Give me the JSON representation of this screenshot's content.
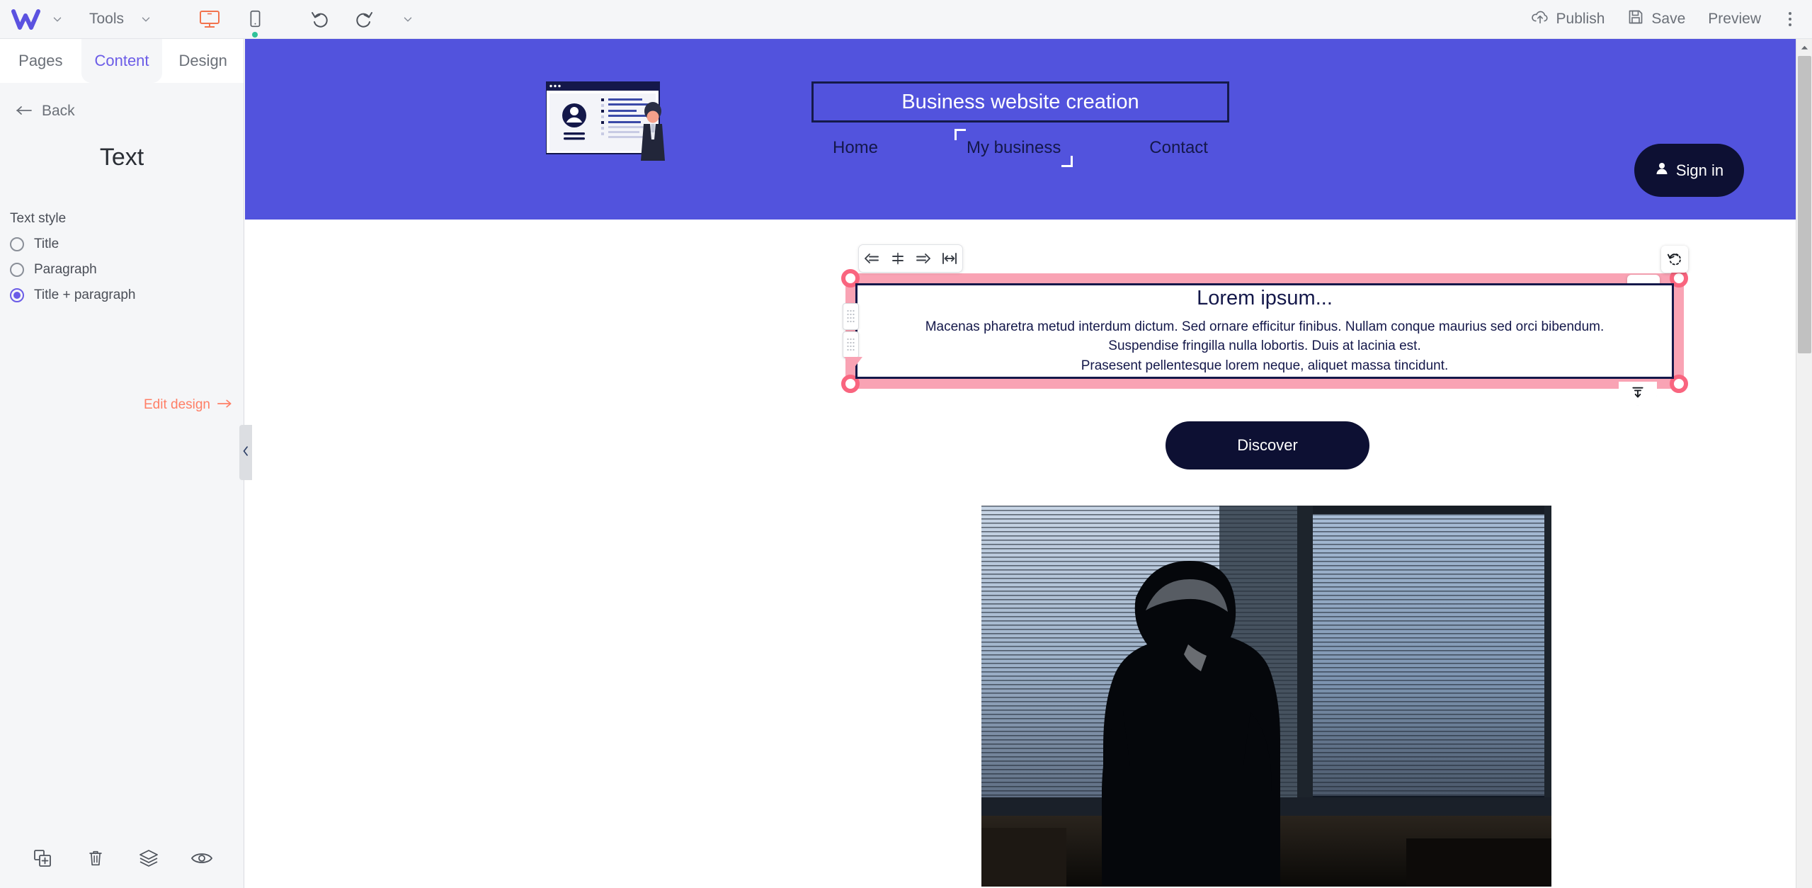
{
  "topbar": {
    "brand_icon": "w-logo-icon",
    "brand_chevron_icon": "chevron-down-icon",
    "tools_label": "Tools",
    "tools_chevron_icon": "chevron-down-icon",
    "desktop_icon": "desktop-monitor-icon",
    "mobile_icon": "mobile-phone-icon",
    "undo_icon": "undo-icon",
    "redo_icon": "redo-icon",
    "history_chevron_icon": "chevron-down-icon",
    "publish_label": "Publish",
    "publish_icon": "cloud-upload-icon",
    "save_label": "Save",
    "save_icon": "floppy-disk-icon",
    "preview_label": "Preview",
    "more_icon": "kebab-menu-icon"
  },
  "left_panel": {
    "tabs": [
      {
        "label": "Pages",
        "active": false
      },
      {
        "label": "Content",
        "active": true
      },
      {
        "label": "Design",
        "active": false
      }
    ],
    "back_label": "Back",
    "back_icon": "arrow-left-icon",
    "title": "Text",
    "section_label": "Text style",
    "text_styles": [
      {
        "label": "Title",
        "selected": false
      },
      {
        "label": "Paragraph",
        "selected": false
      },
      {
        "label": "Title + paragraph",
        "selected": true
      }
    ],
    "edit_design_label": "Edit design",
    "edit_design_icon": "arrow-right-icon",
    "bottom_icons": [
      "duplicate-icon",
      "trash-icon",
      "layers-icon",
      "eye-visibility-icon"
    ],
    "collapse_icon": "chevron-left-icon"
  },
  "canvas": {
    "site_header": {
      "logo_icon": "business-profile-illustration",
      "title": "Business website creation",
      "nav": [
        {
          "label": "Home",
          "hovered": false
        },
        {
          "label": "My business",
          "hovered": true
        },
        {
          "label": "Contact",
          "hovered": false
        }
      ],
      "signin_label": "Sign in",
      "signin_icon": "person-icon"
    },
    "align_toolbar": {
      "icons": [
        "align-left-icon",
        "align-center-icon",
        "align-right-icon",
        "fit-width-icon"
      ]
    },
    "selected_text_block": {
      "title": "Lorem ipsum...",
      "paragraph_lines": [
        "Macenas pharetra metud interdum dictum. Sed ornare efficitur finibus. Nullam conque maurius sed orci bibendum.",
        "Suspendise fringilla nulla lobortis. Duis at lacinia est.",
        "Prasesent pellentesque lorem neque, aliquet massa tincidunt."
      ],
      "options_icon": "ellipsis-icon",
      "rotate_icon": "reset-rotate-icon",
      "insert_below_icon": "insert-below-icon",
      "grip_icon": "drag-grip-icon"
    },
    "discover_button": "Discover",
    "hero_image_alt": "businessman-silhouette-window-blinds"
  },
  "scrollbar": {
    "up_arrow_icon": "scroll-up-arrow-icon"
  },
  "colors": {
    "accent_purple": "#6b5ce7",
    "header_blue": "#5253dd",
    "dark_navy": "#0d1033",
    "selection_pink": "#f9657f",
    "selection_pink_light": "#f9a3b4",
    "orange": "#ff7f66",
    "panel_bg": "#f5f6f8"
  }
}
